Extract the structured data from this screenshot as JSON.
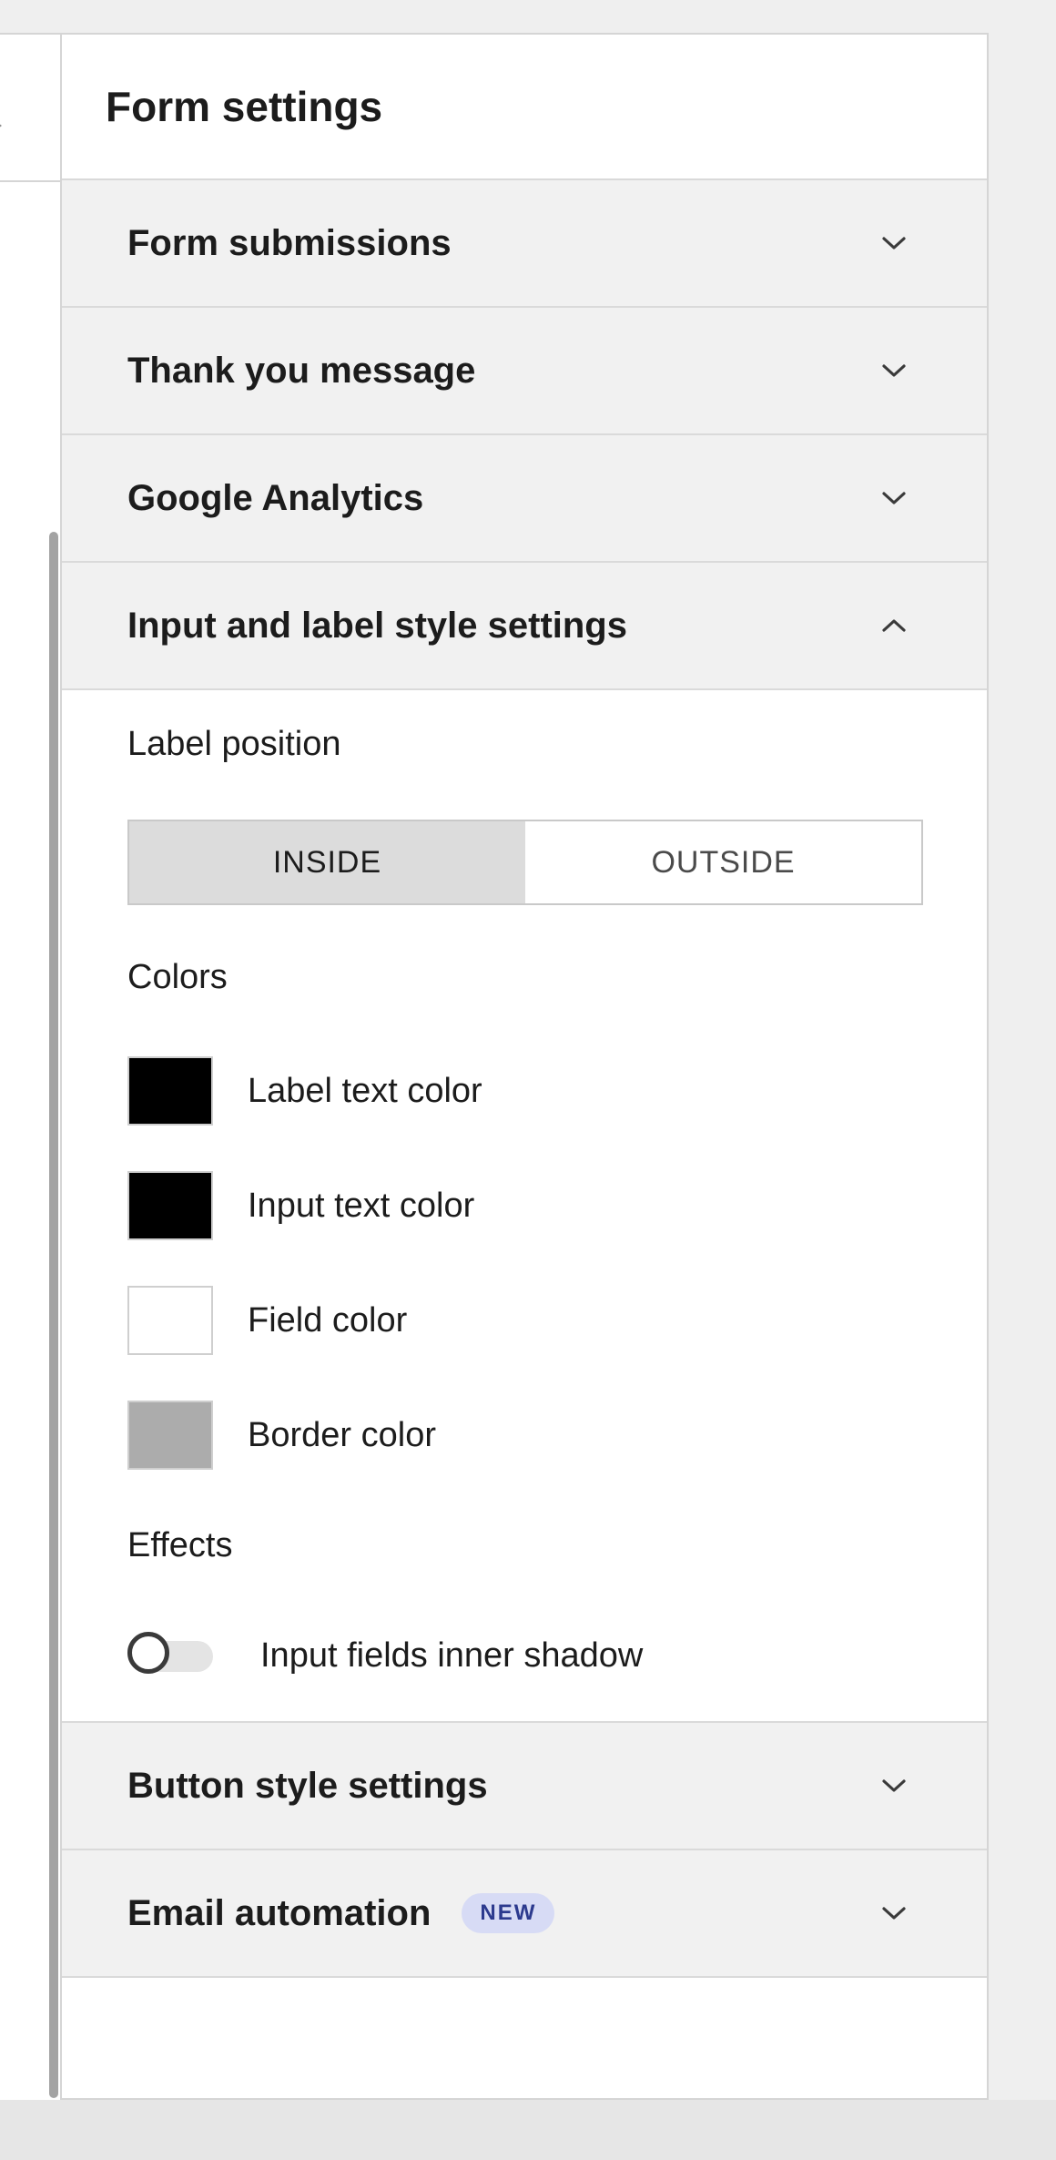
{
  "panel": {
    "title": "Form settings"
  },
  "sections": {
    "form_submissions": {
      "title": "Form submissions",
      "expanded": false
    },
    "thank_you": {
      "title": "Thank you message",
      "expanded": false
    },
    "google_analytics": {
      "title": "Google Analytics",
      "expanded": false
    },
    "input_label_style": {
      "title": "Input and label style settings",
      "expanded": true
    },
    "button_style": {
      "title": "Button style settings",
      "expanded": false
    },
    "email_automation": {
      "title": "Email automation",
      "badge": "NEW",
      "expanded": false
    }
  },
  "input_label_style": {
    "label_position": {
      "label": "Label position",
      "options": [
        "INSIDE",
        "OUTSIDE"
      ],
      "selected": "INSIDE"
    },
    "colors": {
      "heading": "Colors",
      "items": [
        {
          "label": "Label text color",
          "color": "#000000"
        },
        {
          "label": "Input text color",
          "color": "#000000"
        },
        {
          "label": "Field color",
          "color": "#ffffff"
        },
        {
          "label": "Border color",
          "color": "#acacac"
        }
      ]
    },
    "effects": {
      "heading": "Effects",
      "toggle_label": "Input fields inner shadow",
      "enabled": false
    }
  },
  "icons": {
    "collapsed_chevron": "chevron-down-icon",
    "expanded_chevron": "chevron-up-icon"
  }
}
